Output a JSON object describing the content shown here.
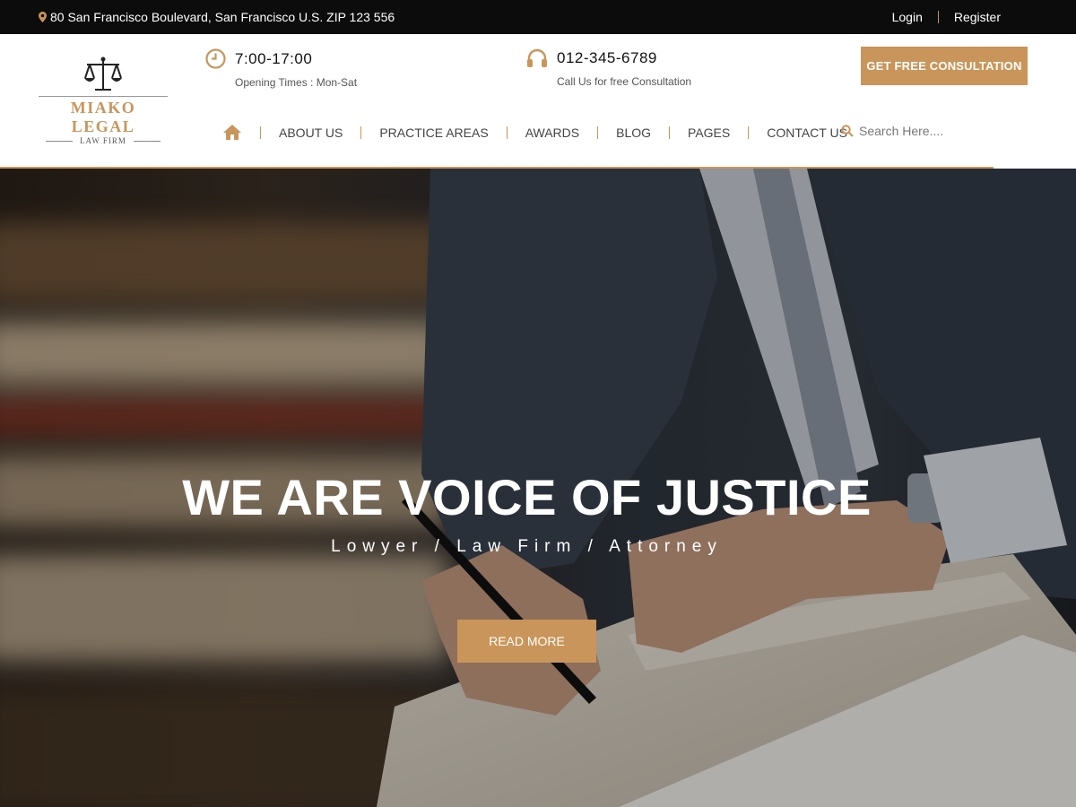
{
  "topbar": {
    "address": "80 San Francisco Boulevard, San Francisco U.S. ZIP 123 556",
    "login": "Login",
    "register": "Register"
  },
  "logo": {
    "name": "MIAKO LEGAL",
    "subtitle": "LAW FIRM"
  },
  "info": {
    "hours": "7:00-17:00",
    "hours_sub": "Opening Times : Mon-Sat",
    "phone": "012-345-6789",
    "phone_sub": "Call Us for free Consultation"
  },
  "cta_label": "GET FREE CONSULTATION",
  "nav": {
    "items": [
      "ABOUT US",
      "PRACTICE AREAS",
      "AWARDS",
      "BLOG",
      "PAGES",
      "CONTACT US"
    ]
  },
  "search": {
    "placeholder": "Search Here...."
  },
  "hero": {
    "title": "WE ARE VOICE OF JUSTICE",
    "tagline": "Lowyer / Law Firm / Attorney",
    "button": "READ MORE"
  },
  "colors": {
    "accent": "#c9955a",
    "topbar": "#0c0c0c"
  },
  "icons": [
    "map-pin-icon",
    "clock-icon",
    "headphones-icon",
    "home-icon",
    "search-icon",
    "scales-of-justice-icon"
  ]
}
